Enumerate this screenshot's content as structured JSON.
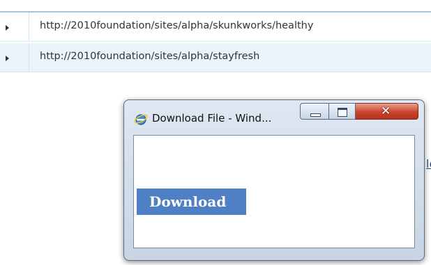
{
  "list": {
    "rows": [
      {
        "url": "http://2010foundation/sites/alpha/skunkworks/healthy"
      },
      {
        "url": "http://2010foundation/sites/alpha/stayfresh"
      }
    ]
  },
  "background": {
    "link_fragment": "le"
  },
  "popup": {
    "title": "Download File - Wind...",
    "icon": "internet-explorer-icon",
    "controls": {
      "minimize": "minimize-icon",
      "maximize": "maximize-icon",
      "close": "close-icon",
      "close_glyph": "✕"
    },
    "download_label": "Download"
  },
  "colors": {
    "download_button": "#4f7fc5",
    "close_button": "#c9442b",
    "row_alt": "#e9f4fb"
  }
}
